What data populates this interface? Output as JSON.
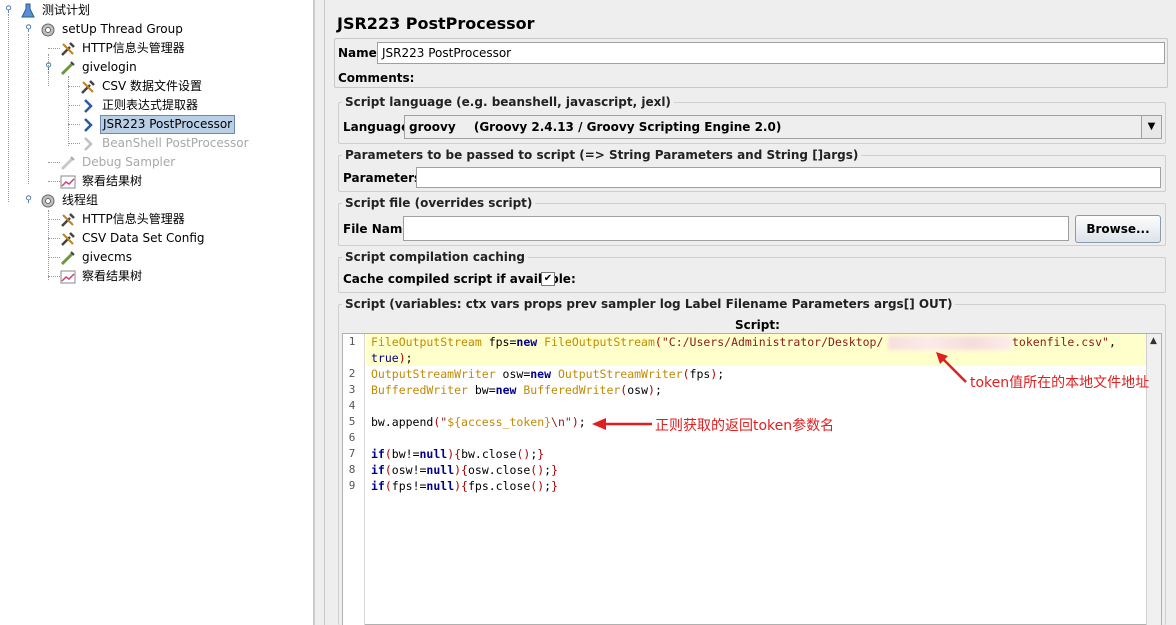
{
  "tree": {
    "items": [
      {
        "label": "测试计划",
        "icon": "test-plan-icon"
      },
      {
        "label": "setUp Thread Group",
        "icon": "gear-icon"
      },
      {
        "label": "HTTP信息头管理器",
        "icon": "wrench-icon"
      },
      {
        "label": "givelogin",
        "icon": "pipette-icon"
      },
      {
        "label": "CSV 数据文件设置",
        "icon": "wrench-icon"
      },
      {
        "label": "正则表达式提取器",
        "icon": "arrow-icon"
      },
      {
        "label": "JSR223 PostProcessor",
        "icon": "arrow-icon"
      },
      {
        "label": "BeanShell PostProcessor",
        "icon": "arrow-icon"
      },
      {
        "label": "Debug Sampler",
        "icon": "pipette-icon"
      },
      {
        "label": "察看结果树",
        "icon": "chart-icon"
      },
      {
        "label": "线程组",
        "icon": "gear-icon"
      },
      {
        "label": "HTTP信息头管理器",
        "icon": "wrench-icon"
      },
      {
        "label": "CSV Data Set Config",
        "icon": "wrench-icon"
      },
      {
        "label": "givecms",
        "icon": "pipette-icon"
      },
      {
        "label": "察看结果树",
        "icon": "chart-icon"
      }
    ]
  },
  "panel": {
    "title": "JSR223 PostProcessor",
    "name_label": "Name:",
    "name_value": "JSR223 PostProcessor",
    "comments_label": "Comments:",
    "script_language": {
      "title": "Script language (e.g. beanshell, javascript, jexl)",
      "label": "Language:",
      "value_short": "groovy",
      "value_long": "(Groovy 2.4.13 / Groovy Scripting Engine 2.0)"
    },
    "parameters": {
      "title": "Parameters to be passed to script (=> String Parameters and String []args)",
      "label": "Parameters:",
      "value": ""
    },
    "script_file": {
      "title": "Script file (overrides script)",
      "label": "File Name:",
      "value": "",
      "browse_label": "Browse..."
    },
    "caching": {
      "title": "Script compilation caching",
      "label": "Cache compiled script if available:",
      "checked": true,
      "check_glyph": "✔"
    },
    "script": {
      "title": "Script (variables: ctx vars props prev sampler log Label Filename Parameters args[] OUT)",
      "header": "Script:",
      "line_numbers": [
        "1",
        "",
        "2",
        "3",
        "4",
        "5",
        "6",
        "7",
        "8",
        "9"
      ]
    }
  },
  "annotations": {
    "file_path_note": "token值所在的本地文件地址",
    "regex_note": "正则获取的返回token参数名"
  },
  "colors": {
    "selection": "#b8cfe5",
    "annotation": "#e02020",
    "line_highlight": "#ffffcc"
  }
}
